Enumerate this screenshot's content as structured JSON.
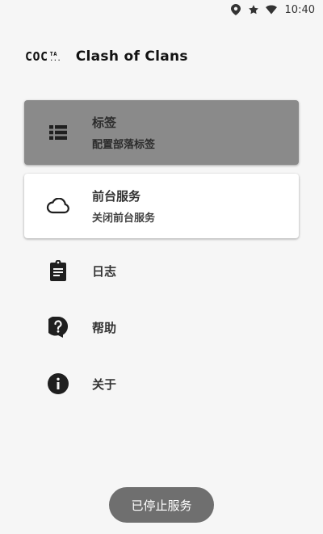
{
  "status_bar": {
    "time": "10:40",
    "icons": [
      "location-icon",
      "star-icon",
      "wifi-icon"
    ]
  },
  "header": {
    "logo_main": "COC",
    "logo_sub_top": "TA",
    "logo_sub_bottom": "...",
    "title": "Clash of Clans"
  },
  "menu": {
    "tags": {
      "title": "标签",
      "subtitle": "配置部落标签",
      "icon": "list-icon"
    },
    "service": {
      "title": "前台服务",
      "subtitle": "关闭前台服务",
      "icon": "cloud-icon"
    },
    "log": {
      "title": "日志",
      "icon": "clipboard-icon"
    },
    "help": {
      "title": "帮助",
      "icon": "help-icon"
    },
    "about": {
      "title": "关于",
      "icon": "info-icon"
    }
  },
  "toast": {
    "text": "已停止服务"
  },
  "colors": {
    "background": "#f6f6f6",
    "active_card": "#8a8a8a",
    "toast": "#6f6f6f"
  }
}
